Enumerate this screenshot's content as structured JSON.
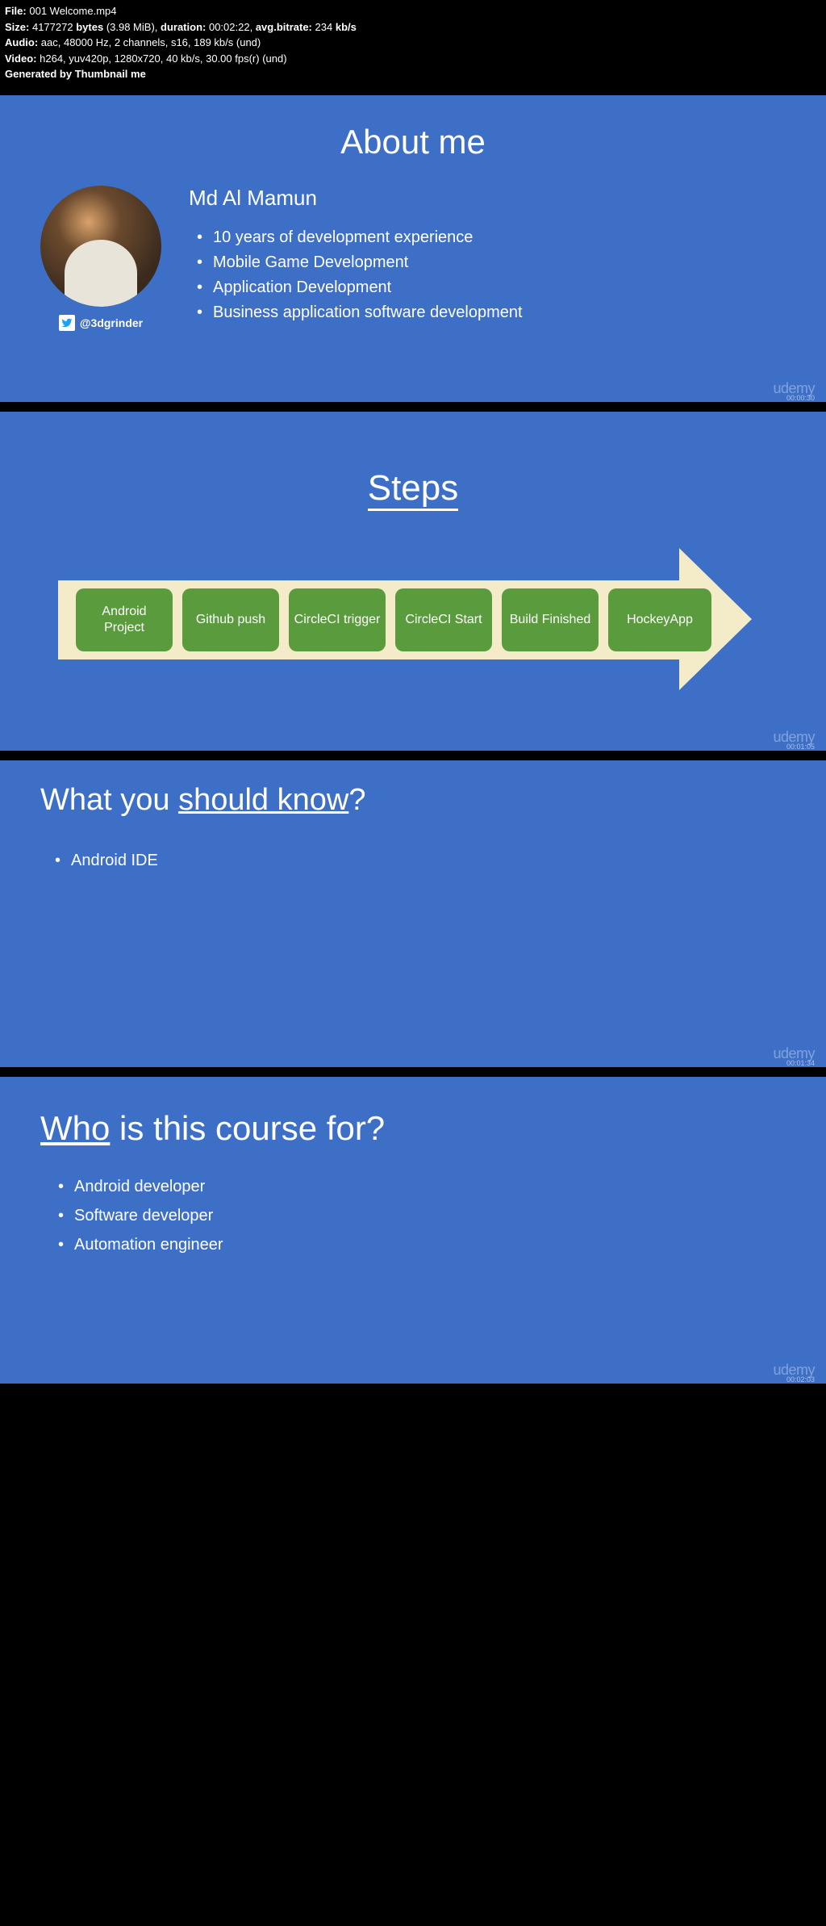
{
  "header": {
    "file_label": "File:",
    "file_value": "001 Welcome.mp4",
    "size_label": "Size:",
    "size_bytes": "4177272",
    "size_bytes_unit": "bytes",
    "size_mib": "(3.98 MiB),",
    "duration_label": "duration:",
    "duration_value": "00:02:22,",
    "avgbitrate_label": "avg.bitrate:",
    "avgbitrate_value": "234",
    "avgbitrate_unit": "kb/s",
    "audio_label": "Audio:",
    "audio_value": "aac, 48000 Hz, 2 channels, s16, 189 kb/s (und)",
    "video_label": "Video:",
    "video_value": "h264, yuv420p, 1280x720, 40 kb/s, 30.00 fps(r) (und)",
    "generated": "Generated by Thumbnail me"
  },
  "watermark": "udemy",
  "slide1": {
    "title": "About me",
    "name": "Md Al Mamun",
    "twitter": "@3dgrinder",
    "bullets": [
      "10 years of development experience",
      "Mobile Game Development",
      "Application Development",
      "Business application software development"
    ],
    "timestamp": "00:00:30"
  },
  "slide2": {
    "title": "Steps",
    "steps": [
      "Android Project",
      "Github push",
      "CircleCI trigger",
      "CircleCI Start",
      "Build Finished",
      "HockeyApp"
    ],
    "timestamp": "00:01:05"
  },
  "slide3": {
    "title_prefix": "What you ",
    "title_underline": "should know",
    "title_suffix": "?",
    "bullets": [
      "Android IDE"
    ],
    "timestamp": "00:01:34"
  },
  "slide4": {
    "title_underline": "Who",
    "title_suffix": " is this course for?",
    "bullets": [
      "Android developer",
      "Software developer",
      "Automation engineer"
    ],
    "timestamp": "00:02:03"
  }
}
